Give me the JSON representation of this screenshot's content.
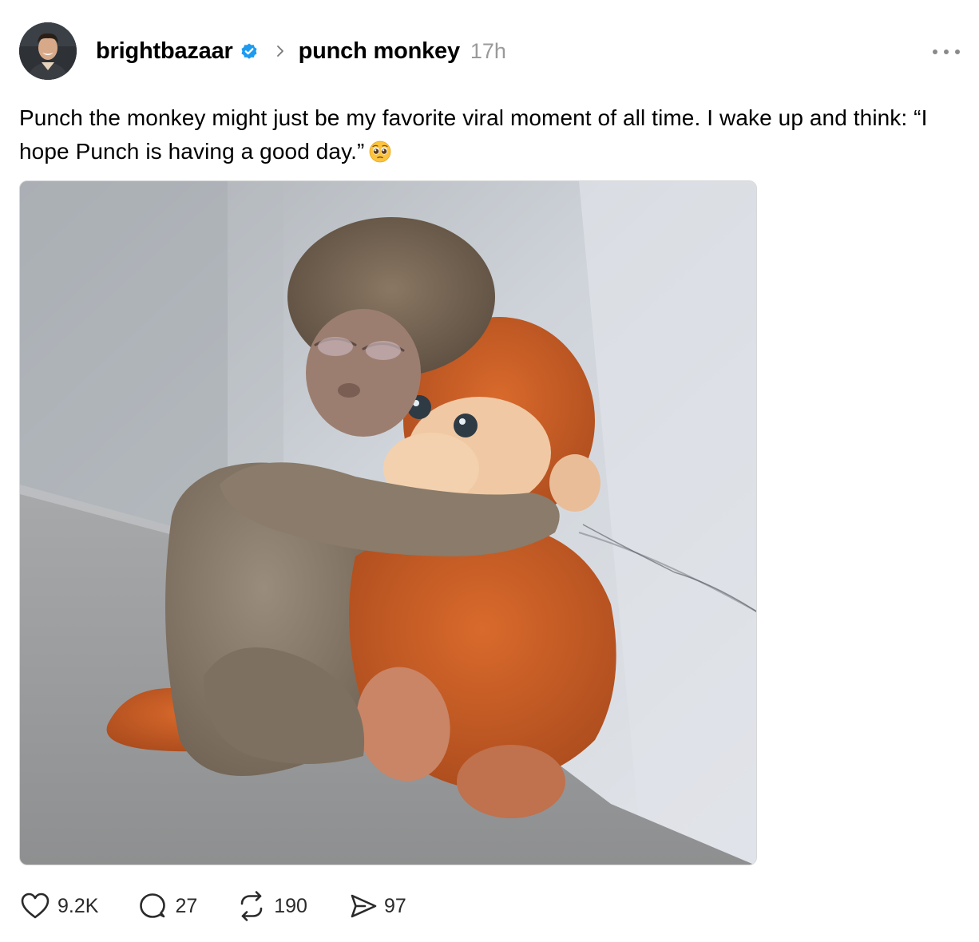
{
  "post": {
    "author": {
      "username": "brightbazaar",
      "verified": true,
      "avatar_icon": "avatar-photo"
    },
    "topic": "punch monkey",
    "timestamp": "17h",
    "text": "Punch the monkey might just be my favorite viral moment of all time. I wake up and think: “I hope Punch is having a good day.”",
    "emoji": "pleading-face-emoji",
    "image_icon": "monkey-hugging-plush-photo",
    "stats": {
      "likes": "9.2K",
      "replies": "27",
      "reposts": "190",
      "shares": "97"
    }
  },
  "colors": {
    "verified_badge": "#1d9bf0",
    "muted_text": "#9a9a9a",
    "icon": "#2a2a2a"
  }
}
